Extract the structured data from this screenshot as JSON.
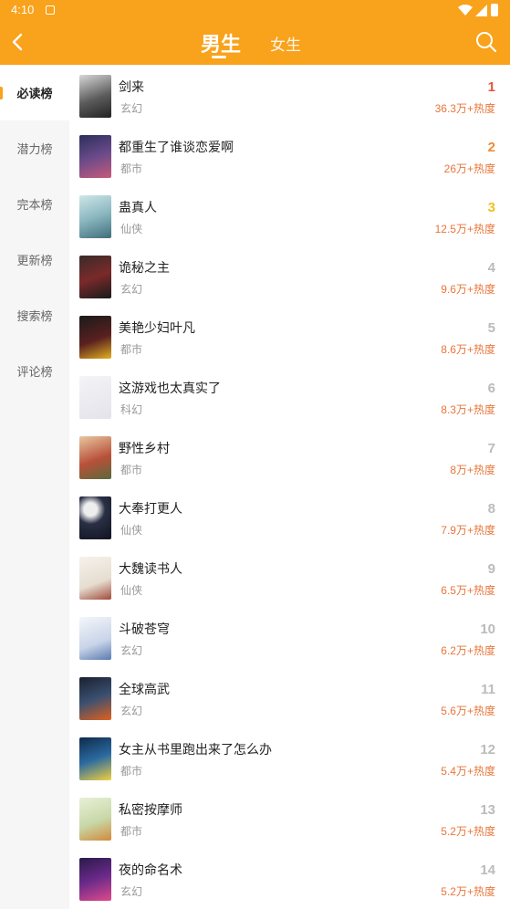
{
  "status_bar": {
    "time": "4:10"
  },
  "header": {
    "tabs": [
      {
        "label": "男生",
        "active": true
      },
      {
        "label": "女生",
        "active": false
      }
    ]
  },
  "sidebar": {
    "items": [
      {
        "label": "必读榜",
        "active": true
      },
      {
        "label": "潜力榜"
      },
      {
        "label": "完本榜"
      },
      {
        "label": "更新榜"
      },
      {
        "label": "搜索榜"
      },
      {
        "label": "评论榜"
      }
    ]
  },
  "colors": {
    "accent": "#f9a21b",
    "heat": "#e8763b",
    "rank1": "#e8543c",
    "rank2": "#f08a32",
    "rank3": "#f3c01e"
  },
  "books": [
    {
      "rank": "1",
      "title": "剑来",
      "genre": "玄幻",
      "heat": "36.3万+热度"
    },
    {
      "rank": "2",
      "title": "都重生了谁谈恋爱啊",
      "genre": "都市",
      "heat": "26万+热度"
    },
    {
      "rank": "3",
      "title": "蛊真人",
      "genre": "仙侠",
      "heat": "12.5万+热度"
    },
    {
      "rank": "4",
      "title": "诡秘之主",
      "genre": "玄幻",
      "heat": "9.6万+热度"
    },
    {
      "rank": "5",
      "title": "美艳少妇叶凡",
      "genre": "都市",
      "heat": "8.6万+热度"
    },
    {
      "rank": "6",
      "title": "这游戏也太真实了",
      "genre": "科幻",
      "heat": "8.3万+热度"
    },
    {
      "rank": "7",
      "title": "野性乡村",
      "genre": "都市",
      "heat": "8万+热度"
    },
    {
      "rank": "8",
      "title": "大奉打更人",
      "genre": "仙侠",
      "heat": "7.9万+热度"
    },
    {
      "rank": "9",
      "title": "大魏读书人",
      "genre": "仙侠",
      "heat": "6.5万+热度"
    },
    {
      "rank": "10",
      "title": "斗破苍穹",
      "genre": "玄幻",
      "heat": "6.2万+热度"
    },
    {
      "rank": "11",
      "title": "全球高武",
      "genre": "玄幻",
      "heat": "5.6万+热度"
    },
    {
      "rank": "12",
      "title": "女主从书里跑出来了怎么办",
      "genre": "都市",
      "heat": "5.4万+热度"
    },
    {
      "rank": "13",
      "title": "私密按摩师",
      "genre": "都市",
      "heat": "5.2万+热度"
    },
    {
      "rank": "14",
      "title": "夜的命名术",
      "genre": "玄幻",
      "heat": "5.2万+热度"
    }
  ]
}
